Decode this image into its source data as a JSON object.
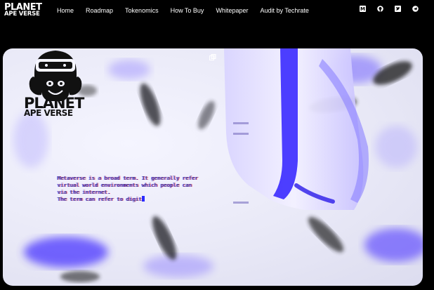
{
  "brand": {
    "line1": "PLANET",
    "line2": "APE VERSE"
  },
  "nav": {
    "links": [
      "Home",
      "Roadmap",
      "Tokenomics",
      "How To Buy",
      "Whitepaper",
      "Audit by Techrate"
    ]
  },
  "socials": [
    "medium-icon",
    "github-icon",
    "twitter-icon",
    "telegram-icon"
  ],
  "hero": {
    "brand_line1": "PLANET",
    "brand_line2": "APE VERSE",
    "text_lines": [
      "Metaverse is a broad term. It generally refer",
      "virtual world environments which people can",
      "via the internet.",
      "The term can refer to digit"
    ]
  },
  "colors": {
    "accent": "#3b2cff",
    "background": "#000000"
  }
}
